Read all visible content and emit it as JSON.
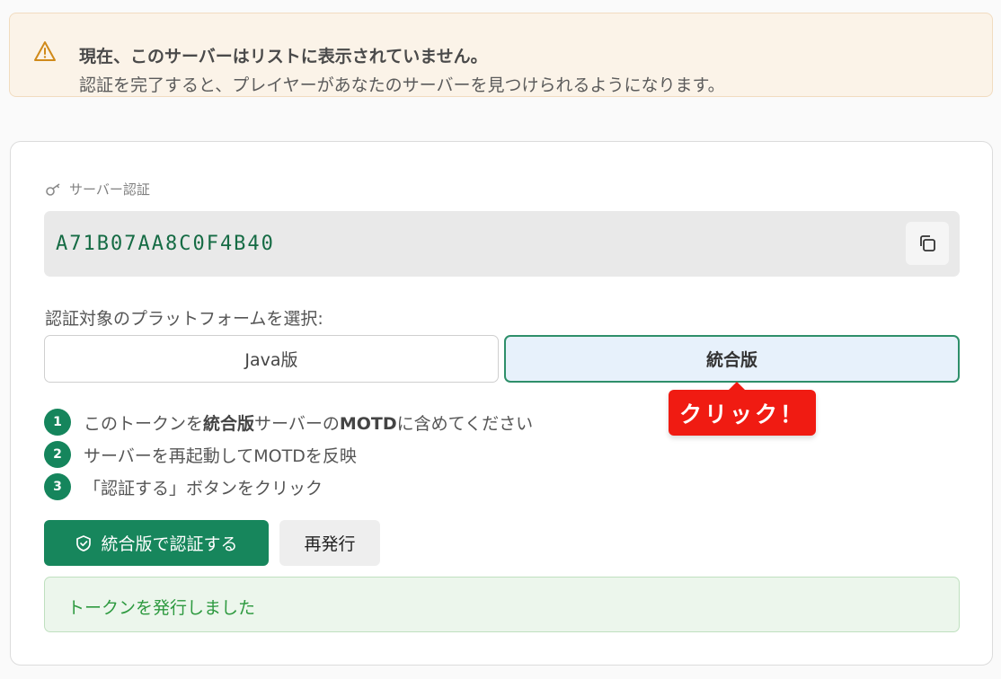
{
  "warning": {
    "title": "現在、このサーバーはリストに表示されていません。",
    "body": "認証を完了すると、プレイヤーがあなたのサーバーを見つけられるようになります。"
  },
  "verification": {
    "label": "サーバー認証",
    "token": "A71B07AA8C0F4B40",
    "platform_label": "認証対象のプラットフォームを選択:",
    "platforms": [
      {
        "label": "Java版",
        "selected": false
      },
      {
        "label": "統合版",
        "selected": true
      }
    ],
    "callout": "クリック！",
    "steps": [
      {
        "num": "1",
        "pre": "このトークンを",
        "bold1": "統合版",
        "mid": "サーバーの",
        "bold2": "MOTD",
        "post": "に含めてください"
      },
      {
        "num": "2",
        "text": "サーバーを再起動してMOTDを反映"
      },
      {
        "num": "3",
        "text": "「認証する」ボタンをクリック"
      }
    ],
    "verify_button": "統合版で認証する",
    "reissue_button": "再発行",
    "success_message": "トークンを発行しました"
  },
  "colors": {
    "accent": "#17865c",
    "callout": "#f01b12",
    "token_text": "#156b44"
  }
}
